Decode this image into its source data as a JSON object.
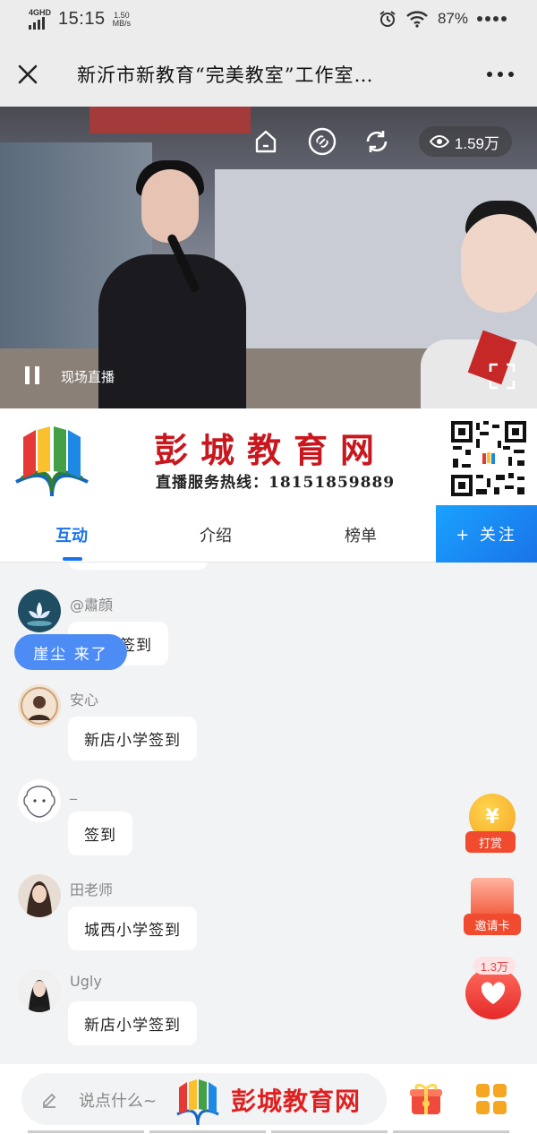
{
  "status_bar": {
    "network": "4GHD",
    "time": "15:15",
    "speed_value": "1.50",
    "speed_unit": "MB/s",
    "battery": "87%"
  },
  "header": {
    "title": "新沂市新教育“完美教室”工作室…",
    "close_icon": "close-icon",
    "more_icon": "more-icon"
  },
  "video": {
    "viewer_count": "1.59万",
    "live_label": "现场直播"
  },
  "banner": {
    "title": "彭城教育网",
    "hotline": "直播服务热线：18151859889"
  },
  "tabs": [
    {
      "label": "互动",
      "active": true
    },
    {
      "label": "介绍",
      "active": false
    },
    {
      "label": "榜单",
      "active": false
    }
  ],
  "follow_button": "+ 关注",
  "chat": {
    "notice": "崖尘 来了",
    "messages": [
      {
        "user": "@肅顔",
        "text": "签到"
      },
      {
        "user": "安心",
        "text": "新店小学签到"
      },
      {
        "user": "_",
        "text": "签到"
      },
      {
        "user": "田老师",
        "text": "城西小学签到"
      },
      {
        "user": "Ugly",
        "text": "新店小学签到"
      }
    ]
  },
  "float": {
    "reward_label": "打赏",
    "reward_symbol": "¥",
    "invite_label": "邀请卡",
    "like_count": "1.3万"
  },
  "bottom_bar": {
    "comment_placeholder": "说点什么~",
    "watermark_text": "彭城教育网"
  },
  "colors": {
    "accent": "#1a73e8",
    "brand_red": "#c8171e",
    "notice_blue": "#4d8cf5"
  }
}
